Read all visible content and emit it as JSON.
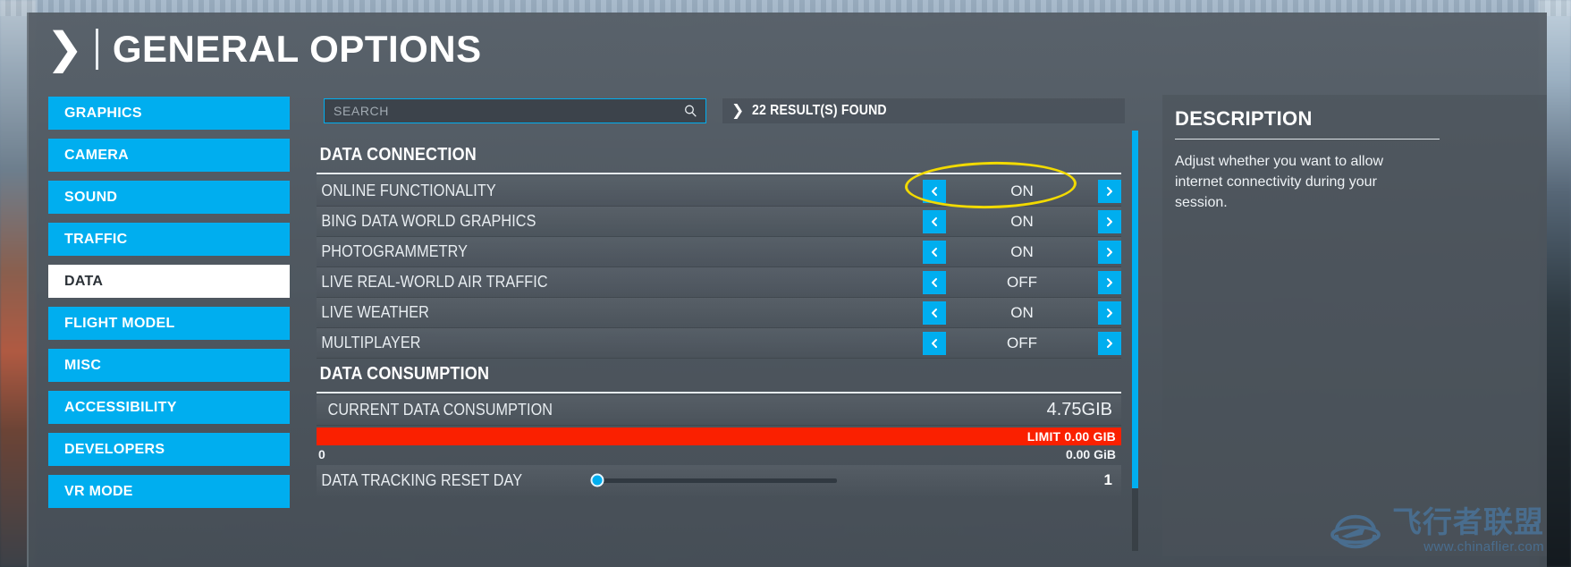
{
  "header": {
    "chevron_icon": "chevron-right-icon",
    "title": "GENERAL OPTIONS"
  },
  "sidebar": {
    "items": [
      {
        "label": "GRAPHICS",
        "active": false
      },
      {
        "label": "CAMERA",
        "active": false
      },
      {
        "label": "SOUND",
        "active": false
      },
      {
        "label": "TRAFFIC",
        "active": false
      },
      {
        "label": "DATA",
        "active": true
      },
      {
        "label": "FLIGHT MODEL",
        "active": false
      },
      {
        "label": "MISC",
        "active": false
      },
      {
        "label": "ACCESSIBILITY",
        "active": false
      },
      {
        "label": "DEVELOPERS",
        "active": false
      },
      {
        "label": "VR MODE",
        "active": false
      }
    ]
  },
  "search": {
    "value": "",
    "placeholder": "SEARCH",
    "icon": "search-icon",
    "results_chevron_icon": "chevron-right-icon",
    "results_text": "22 RESULT(S) FOUND"
  },
  "groups": [
    {
      "title": "DATA CONNECTION",
      "rows": [
        {
          "label": "ONLINE FUNCTIONALITY",
          "value": "ON"
        },
        {
          "label": "BING DATA WORLD GRAPHICS",
          "value": "ON"
        },
        {
          "label": "PHOTOGRAMMETRY",
          "value": "ON"
        },
        {
          "label": "LIVE REAL-WORLD AIR TRAFFIC",
          "value": "OFF"
        },
        {
          "label": "LIVE WEATHER",
          "value": "ON"
        },
        {
          "label": "MULTIPLAYER",
          "value": "OFF"
        }
      ]
    }
  ],
  "consumption": {
    "title": "DATA CONSUMPTION",
    "current_label": "CURRENT DATA CONSUMPTION",
    "current_value": "4.75GIB",
    "bar_limit_label": "LIMIT 0.00 GIB",
    "scale_min": "0",
    "scale_max": "0.00 GiB",
    "bar_fill_percent": 100,
    "bar_color": "#FA2000",
    "reset_day_label": "DATA TRACKING RESET DAY",
    "reset_day_value": "1",
    "reset_day_slider_percent": 0
  },
  "description": {
    "title": "DESCRIPTION",
    "text": "Adjust whether you want to allow internet connectivity during your session."
  },
  "watermark": {
    "logo_icon": "airplane-ring-logo-icon",
    "name": "飞行者联盟",
    "url": "www.chinaflier.com"
  },
  "annotation": {
    "shape": "ellipse",
    "color": "#F2DA00",
    "targets": "ONLINE FUNCTIONALITY value"
  },
  "colors": {
    "accent": "#00AEEF",
    "alert": "#FA2000",
    "annotation": "#F2DA00",
    "panel": "#545C64"
  }
}
